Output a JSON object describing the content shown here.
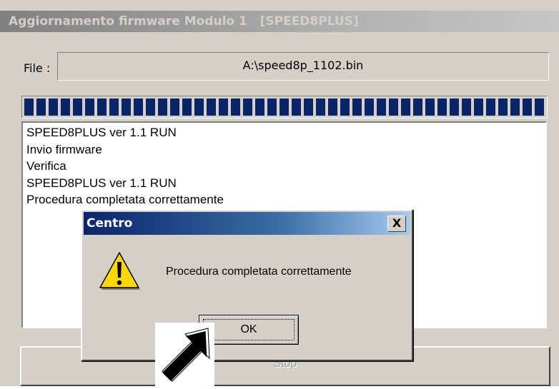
{
  "window": {
    "title": "Aggiornamento firmware Modulo 1   [SPEED8PLUS]"
  },
  "file": {
    "label": "File :",
    "value": "A:\\speed8p_1102.bin"
  },
  "progress": {
    "percent": 100,
    "color": "#0a246a"
  },
  "log": {
    "lines": [
      "SPEED8PLUS ver 1.1 RUN",
      "Invio firmware",
      "Verifica",
      "SPEED8PLUS ver 1.1 RUN",
      "Procedura completata correttamente"
    ]
  },
  "stop_button": {
    "label": "Stop",
    "enabled": false
  },
  "dialog": {
    "title": "Centro",
    "close_label": "X",
    "icon": "warning-icon",
    "message": "Procedura completata correttamente",
    "ok_label": "OK"
  },
  "cursor": {
    "icon": "arrow-cursor-icon"
  }
}
